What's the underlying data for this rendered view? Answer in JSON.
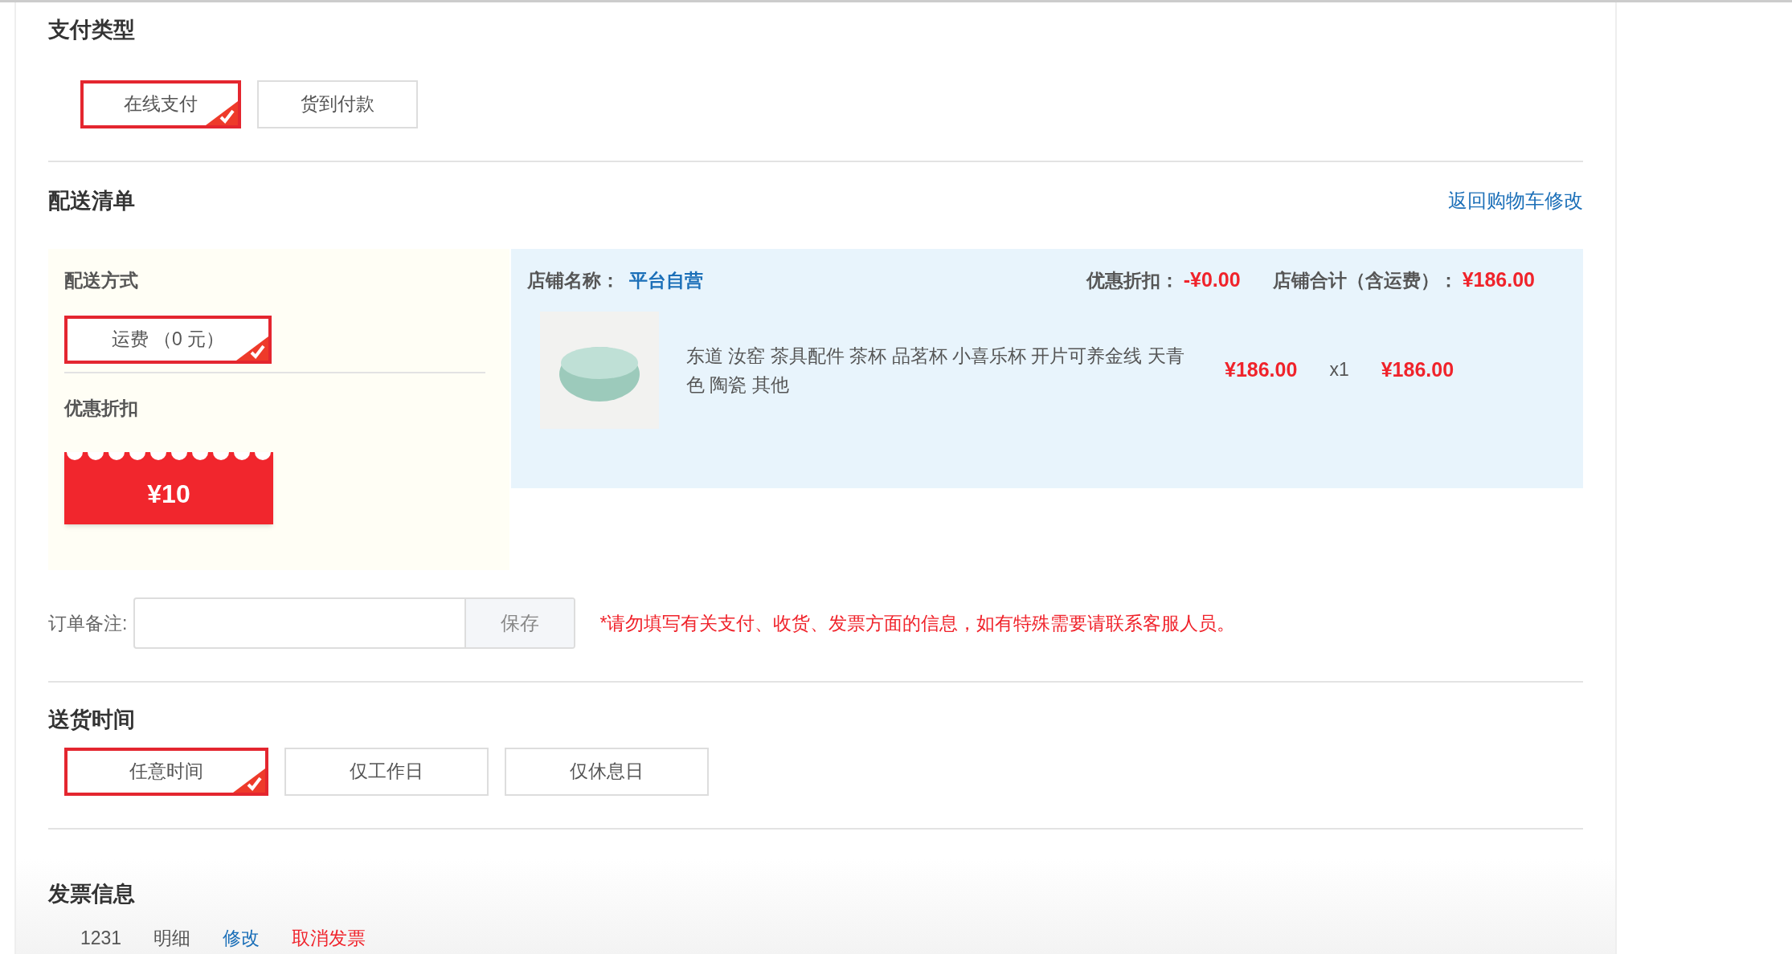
{
  "payment_type": {
    "title": "支付类型",
    "options": [
      {
        "label": "在线支付",
        "selected": true
      },
      {
        "label": "货到付款",
        "selected": false
      }
    ]
  },
  "delivery_list": {
    "title": "配送清单",
    "back_link": "返回购物车修改",
    "shipping": {
      "title": "配送方式",
      "options": [
        {
          "label": "运费 （0 元）",
          "selected": true
        }
      ]
    },
    "discount": {
      "title": "优惠折扣",
      "coupons": [
        {
          "amount": "¥10"
        }
      ]
    },
    "store": {
      "name_label": "店铺名称：",
      "name": "平台自营",
      "discount_label": "优惠折扣：",
      "discount": "-¥0.00",
      "total_label": "店铺合计（含运费）：",
      "total": "¥186.00",
      "items": [
        {
          "title": "东道 汝窑 茶具配件 茶杯 品茗杯 小喜乐杯 开片可养金线 天青色 陶瓷 其他",
          "price": "¥186.00",
          "quantity": "x1",
          "subtotal": "¥186.00"
        }
      ]
    }
  },
  "order_note": {
    "label": "订单备注:",
    "save_button": "保存",
    "warning": "*请勿填写有关支付、收货、发票方面的信息，如有特殊需要请联系客服人员。"
  },
  "delivery_time": {
    "title": "送货时间",
    "options": [
      {
        "label": "任意时间",
        "selected": true
      },
      {
        "label": "仅工作日",
        "selected": false
      },
      {
        "label": "仅休息日",
        "selected": false
      }
    ]
  },
  "invoice": {
    "title": "发票信息",
    "value": "1231",
    "type": "明细",
    "edit_link": "修改",
    "cancel_link": "取消发票"
  }
}
